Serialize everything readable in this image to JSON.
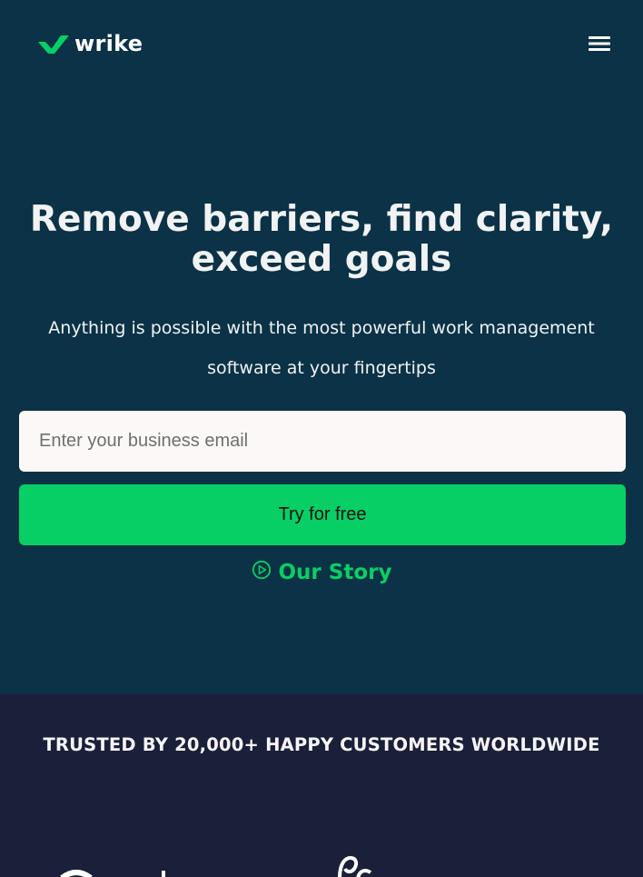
{
  "brand": {
    "name": "wrike",
    "accent_color": "#08cf65",
    "hero_bg": "#0b3246",
    "trusted_bg": "#1a1f3a",
    "logo_icon": "wrike-checkmark-logo"
  },
  "header": {
    "menu_icon": "hamburger-menu-icon"
  },
  "hero": {
    "headline": "Remove barriers, find clarity, exceed goals",
    "subheadline": "Anything is possible with the most powerful work management software at your fingertips",
    "email_input": {
      "value": "",
      "placeholder": "Enter your business email"
    },
    "cta_label": "Try for free",
    "story_link": {
      "icon": "play-circle-icon",
      "label": "Our Story"
    }
  },
  "trusted": {
    "title": "TRUSTED BY 20,000+ HAPPY CUSTOMERS WORLDWIDE"
  }
}
